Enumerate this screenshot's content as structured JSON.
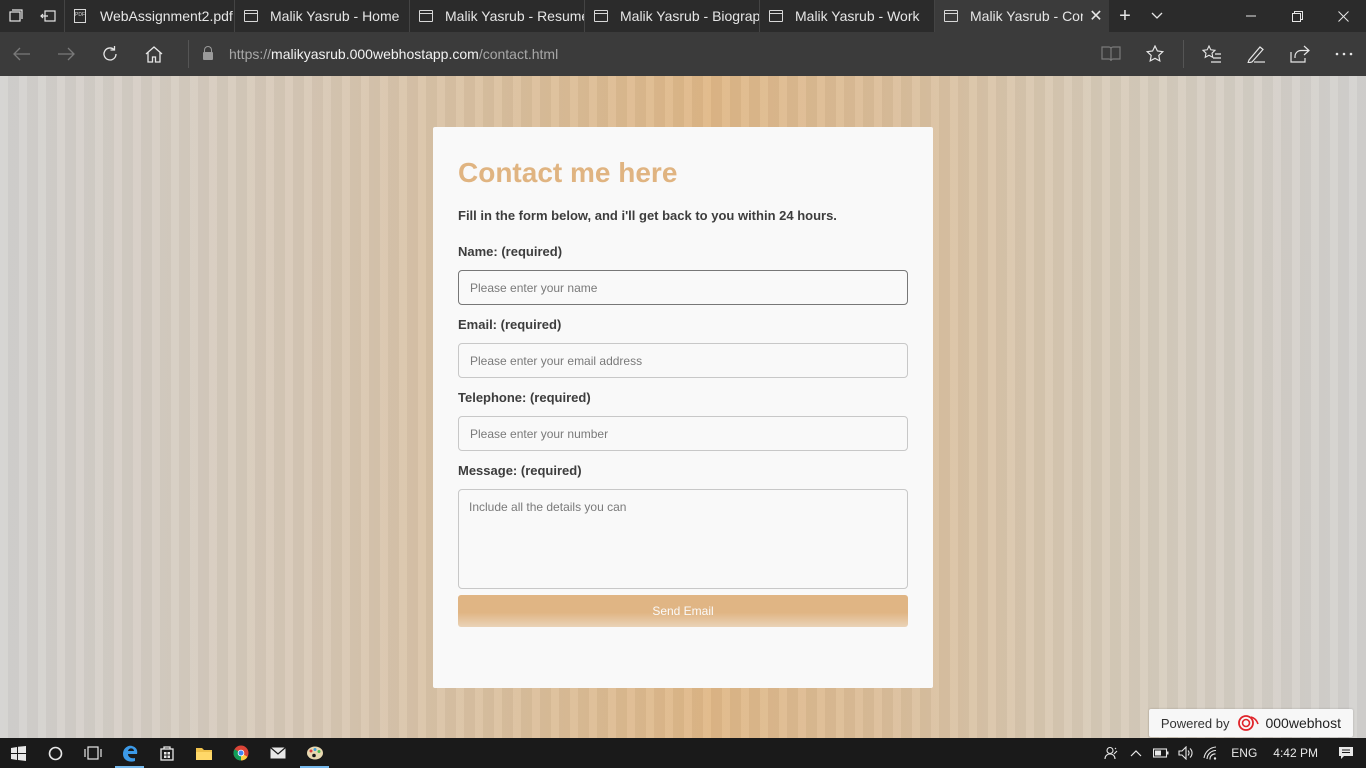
{
  "browser": {
    "tabs": [
      {
        "title": "WebAssignment2.pdf",
        "icon": "pdf-icon",
        "active": false
      },
      {
        "title": "Malik Yasrub - Home",
        "icon": "page-icon",
        "active": false
      },
      {
        "title": "Malik Yasrub - Resume",
        "icon": "page-icon",
        "active": false
      },
      {
        "title": "Malik Yasrub - Biograpl",
        "icon": "page-icon",
        "active": false
      },
      {
        "title": "Malik Yasrub - Work",
        "icon": "page-icon",
        "active": false
      },
      {
        "title": "Malik Yasrub - Con",
        "icon": "page-icon",
        "active": true
      }
    ],
    "url_scheme": "https://",
    "url_host": "malikyasrub.000webhostapp.com",
    "url_path": "/contact.html"
  },
  "contact": {
    "title": "Contact me here",
    "intro": "Fill in the form below, and i'll get back to you within 24 hours.",
    "name_label": "Name: (required)",
    "name_placeholder": "Please enter your name",
    "email_label": "Email: (required)",
    "email_placeholder": "Please enter your email address",
    "phone_label": "Telephone: (required)",
    "phone_placeholder": "Please enter your number",
    "message_label": "Message: (required)",
    "message_placeholder": "Include all the details you can",
    "send_label": "Send Email"
  },
  "badge": {
    "powered_by": "Powered by",
    "brand": "000webhost"
  },
  "taskbar": {
    "language": "ENG",
    "time": "4:42 PM"
  },
  "colors": {
    "accent": "#e0b481",
    "card_bg": "#f9f9f9"
  }
}
